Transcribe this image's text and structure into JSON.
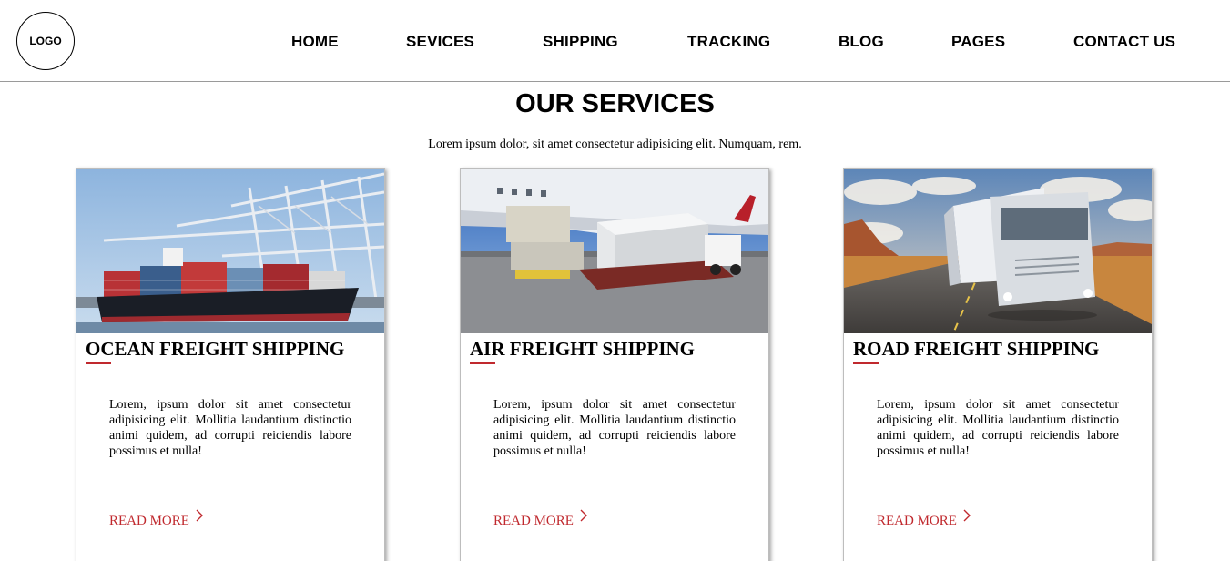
{
  "header": {
    "logo_text": "LOGO",
    "nav": [
      {
        "label": "HOME"
      },
      {
        "label": "SEVICES"
      },
      {
        "label": "SHIPPING"
      },
      {
        "label": "TRACKING"
      },
      {
        "label": "BLOG"
      },
      {
        "label": "PAGES"
      },
      {
        "label": "CONTACT US"
      }
    ]
  },
  "services": {
    "title": "OUR SERVICES",
    "subtitle": "Lorem ipsum dolor, sit amet consectetur adipisicing elit. Numquam, rem.",
    "cards": [
      {
        "title": "OCEAN FREIGHT SHIPPING",
        "text": "Lorem, ipsum dolor sit amet consectetur adipisicing elit. Mollitia laudantium distinctio animi quidem, ad corrupti reiciendis labore possimus et nulla!",
        "link": "READ MORE",
        "image": "cargo-ship-photo"
      },
      {
        "title": "AIR FREIGHT SHIPPING",
        "text": "Lorem, ipsum dolor sit amet consectetur adipisicing elit. Mollitia laudantium distinctio animi quidem, ad corrupti reiciendis labore possimus et nulla!",
        "link": "READ MORE",
        "image": "cargo-plane-photo"
      },
      {
        "title": "ROAD FREIGHT SHIPPING",
        "text": "Lorem, ipsum dolor sit amet consectetur adipisicing elit. Mollitia laudantium distinctio animi quidem, ad corrupti reiciendis labore possimus et nulla!",
        "link": "READ MORE",
        "image": "truck-road-photo"
      }
    ]
  },
  "colors": {
    "accent": "#c0292e",
    "text": "#000000",
    "background": "#ffffff"
  },
  "icons": {
    "read_more": "chevron-right-icon"
  }
}
